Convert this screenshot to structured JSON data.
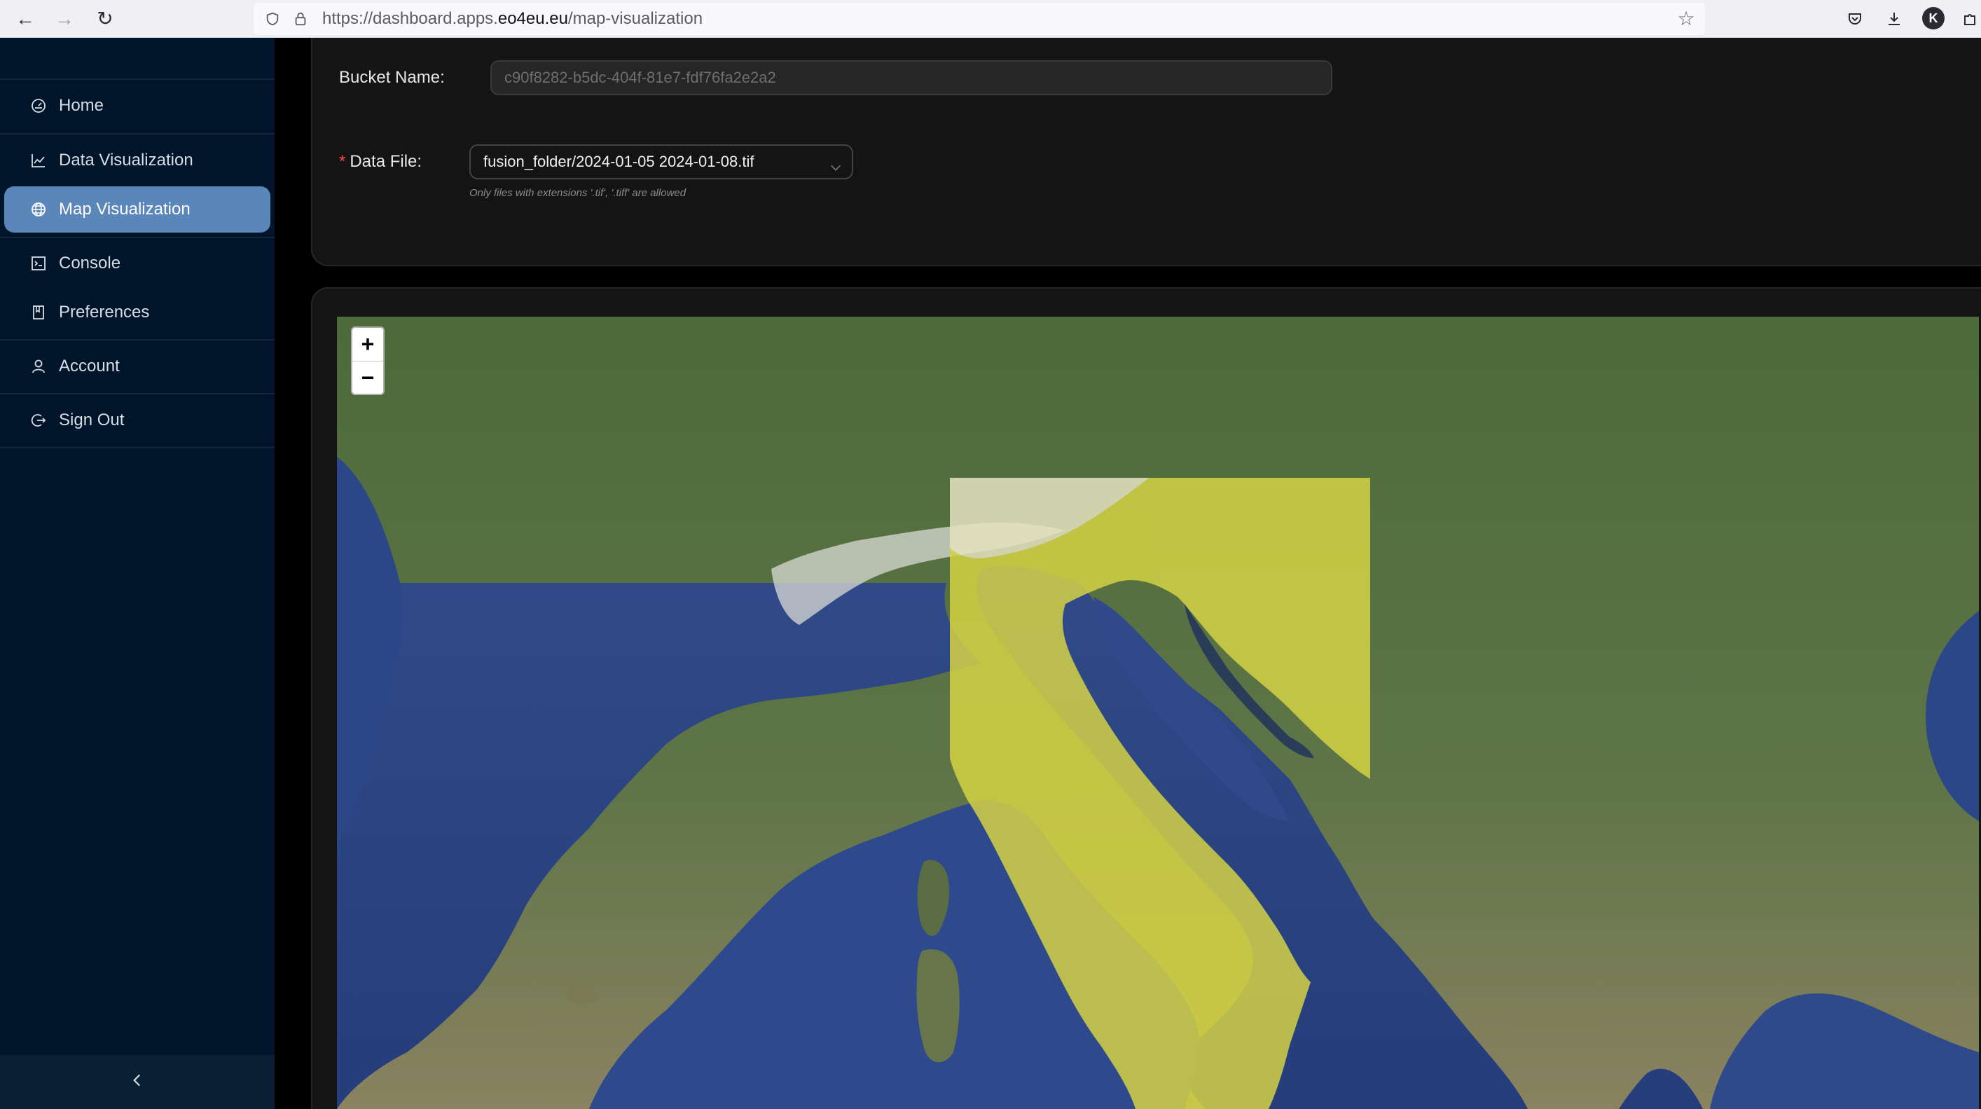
{
  "browser": {
    "url_prefix": "https://dashboard.apps.",
    "url_host": "eo4eu.eu",
    "url_path": "/map-visualization",
    "profile_initial": "K"
  },
  "sidebar": {
    "items": [
      {
        "label": "Home",
        "icon": "dashboard-gauge-icon",
        "active": false
      },
      {
        "label": "Data Visualization",
        "icon": "line-chart-icon",
        "active": false
      },
      {
        "label": "Map Visualization",
        "icon": "globe-icon",
        "active": true
      },
      {
        "label": "Console",
        "icon": "terminal-icon",
        "active": false
      },
      {
        "label": "Preferences",
        "icon": "bookmark-icon",
        "active": false
      },
      {
        "label": "Account",
        "icon": "user-icon",
        "active": false
      },
      {
        "label": "Sign Out",
        "icon": "logout-icon",
        "active": false
      }
    ],
    "collapse_icon": "chevron-left-icon"
  },
  "form": {
    "bucket_label": "Bucket Name",
    "bucket_value": "c90f8282-b5dc-404f-81e7-fdf76fa2e2a2",
    "data_file_required_mark": "*",
    "data_file_label": "Data File",
    "data_file_value": "fusion_folder/2024-01-05 2024-01-08.tif",
    "data_file_help": "Only files with extensions '.tif', '.tiff' are allowed"
  },
  "map": {
    "zoom_in": "+",
    "zoom_out": "−",
    "overlay_color": "#d4d244",
    "sea_color": "#2f4787",
    "land_color": "#4f6b3b"
  }
}
